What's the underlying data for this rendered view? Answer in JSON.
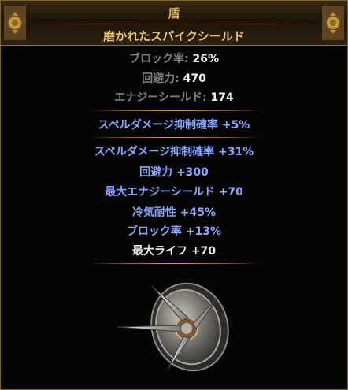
{
  "header": {
    "item_class": "盾",
    "item_name": "磨かれたスパイクシールド"
  },
  "properties": [
    {
      "label": "ブロック率:",
      "value": "26%"
    },
    {
      "label": "回避力:",
      "value": "470"
    },
    {
      "label": "エナジーシールド:",
      "value": "174"
    }
  ],
  "implicit": "スペルダメージ抑制確率 +5%",
  "mods": [
    "スペルダメージ抑制確率 +31%",
    "回避力 +300",
    "最大エナジーシールド +70",
    "冷気耐性 +45%",
    "ブロック率 +13%"
  ],
  "crafted": "最大ライフ +70",
  "colors": {
    "property_label": "#7f7f7f",
    "property_value": "#f2f2f2",
    "magic_mod": "#8aa6ff",
    "title": "#e7c174"
  },
  "icons": [
    "shield-image",
    "corner-ornament-icon"
  ]
}
